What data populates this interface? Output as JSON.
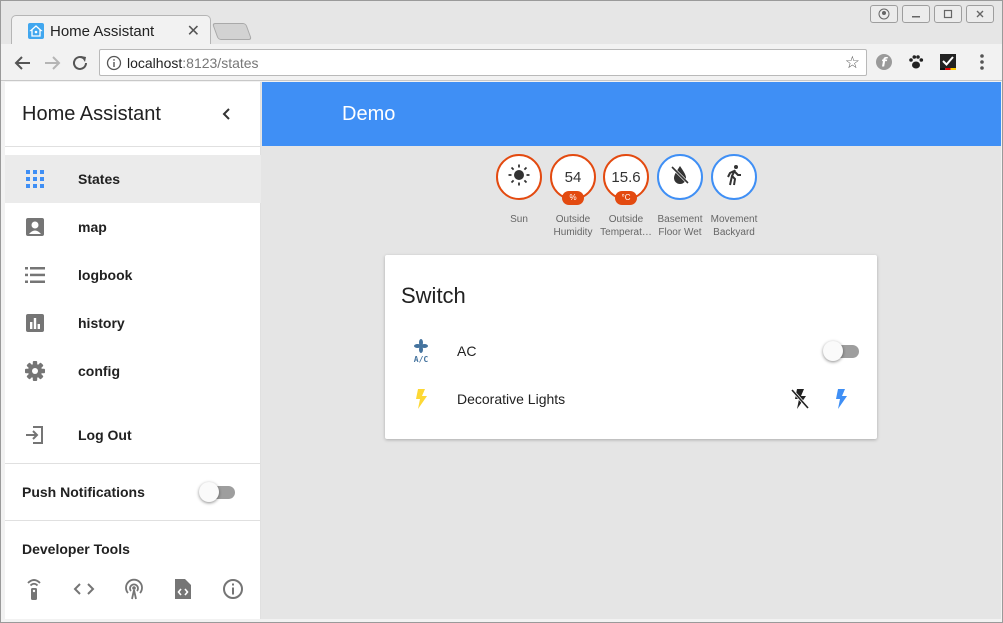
{
  "browser": {
    "tab": {
      "title": "Home Assistant"
    },
    "address": {
      "host": "localhost",
      "rest": ":8123/states"
    }
  },
  "sidebar": {
    "title": "Home Assistant",
    "items": [
      {
        "label": "States",
        "icon": "grid-icon"
      },
      {
        "label": "map",
        "icon": "account-box-icon"
      },
      {
        "label": "logbook",
        "icon": "list-icon"
      },
      {
        "label": "history",
        "icon": "bar-chart-icon"
      },
      {
        "label": "config",
        "icon": "gear-icon"
      }
    ],
    "logout": {
      "label": "Log Out",
      "icon": "logout-icon"
    },
    "push_notifications": {
      "label": "Push Notifications",
      "enabled": false
    },
    "developer_tools": {
      "label": "Developer Tools",
      "icons": [
        "remote-icon",
        "code-icon",
        "broadcast-icon",
        "file-code-icon",
        "info-icon"
      ]
    }
  },
  "header": {
    "title": "Demo"
  },
  "badges": [
    {
      "value": "",
      "unit": "",
      "label": "Sun",
      "icon": "sun-icon",
      "color": "#e34a10"
    },
    {
      "value": "54",
      "unit": "%",
      "label": "Outside Humidity",
      "icon": "",
      "color": "#e34a10"
    },
    {
      "value": "15.6",
      "unit": "°C",
      "label": "Outside Temperat…",
      "icon": "",
      "color": "#e34a10"
    },
    {
      "value": "",
      "unit": "",
      "label": "Basement Floor Wet",
      "icon": "water-off-icon",
      "color": "#3f8ff5"
    },
    {
      "value": "",
      "unit": "",
      "label": "Movement Backyard",
      "icon": "walk-icon",
      "color": "#3f8ff5"
    }
  ],
  "card": {
    "title": "Switch",
    "entities": [
      {
        "name": "AC",
        "icon": "air-conditioner-icon",
        "state": "off"
      },
      {
        "name": "Decorative Lights",
        "icon": "flash-icon",
        "state": "on"
      }
    ]
  },
  "colors": {
    "primary": "#3f8ff5",
    "accent": "#e34a10",
    "light_on": "#fdd835"
  }
}
